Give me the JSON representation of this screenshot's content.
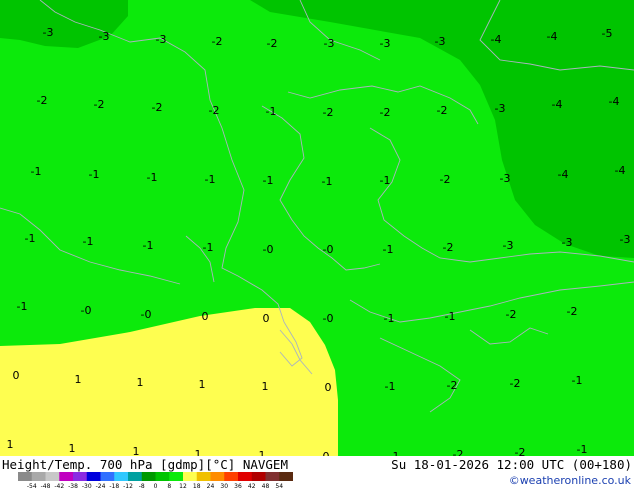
{
  "colors": {
    "dark_green": "#00c400",
    "light_green": "#0cea0b",
    "yellow": "#fefe50",
    "coast": "#aab4bf",
    "credit": "#1a3fb0"
  },
  "labels": [
    {
      "t": "-3"
    },
    {
      "t": "-3"
    },
    {
      "t": "-3"
    },
    {
      "t": "-2"
    },
    {
      "t": "-2"
    },
    {
      "t": "-3"
    },
    {
      "t": "-3"
    },
    {
      "t": "-3"
    },
    {
      "t": "-4"
    },
    {
      "t": "-4"
    },
    {
      "t": "-5"
    },
    {
      "t": "-2"
    },
    {
      "t": "-2"
    },
    {
      "t": "-2"
    },
    {
      "t": "-2"
    },
    {
      "t": "-1"
    },
    {
      "t": "-2"
    },
    {
      "t": "-2"
    },
    {
      "t": "-2"
    },
    {
      "t": "-3"
    },
    {
      "t": "-4"
    },
    {
      "t": "-4"
    },
    {
      "t": "-1"
    },
    {
      "t": "-1"
    },
    {
      "t": "-1"
    },
    {
      "t": "-1"
    },
    {
      "t": "-1"
    },
    {
      "t": "-1"
    },
    {
      "t": "-1"
    },
    {
      "t": "-2"
    },
    {
      "t": "-3"
    },
    {
      "t": "-4"
    },
    {
      "t": "-4"
    },
    {
      "t": "-1"
    },
    {
      "t": "-1"
    },
    {
      "t": "-1"
    },
    {
      "t": "-1"
    },
    {
      "t": "-0"
    },
    {
      "t": "-0"
    },
    {
      "t": "-1"
    },
    {
      "t": "-2"
    },
    {
      "t": "-3"
    },
    {
      "t": "-3"
    },
    {
      "t": "-3"
    },
    {
      "t": "-1"
    },
    {
      "t": "-0"
    },
    {
      "t": "-0"
    },
    {
      "t": "0"
    },
    {
      "t": "0"
    },
    {
      "t": "-0"
    },
    {
      "t": "-1"
    },
    {
      "t": "-1"
    },
    {
      "t": "-2"
    },
    {
      "t": "-2"
    },
    {
      "t": "0"
    },
    {
      "t": "1"
    },
    {
      "t": "1"
    },
    {
      "t": "1"
    },
    {
      "t": "1"
    },
    {
      "t": "0"
    },
    {
      "t": "-1"
    },
    {
      "t": "-2"
    },
    {
      "t": "-2"
    },
    {
      "t": "-1"
    },
    {
      "t": "1"
    },
    {
      "t": "1"
    },
    {
      "t": "1"
    },
    {
      "t": "1"
    },
    {
      "t": "1"
    },
    {
      "t": "0"
    },
    {
      "t": "-1"
    },
    {
      "t": "-2"
    },
    {
      "t": "-2"
    },
    {
      "t": "-1"
    }
  ],
  "footer": {
    "left": "Height/Temp. 700 hPa [gdmp][°C] NAVGEM",
    "right": "Su 18-01-2026 12:00 UTC (00+180)",
    "credit": "©weatheronline.co.uk"
  },
  "scale": {
    "ticks": [
      "-54",
      "-48",
      "-42",
      "-38",
      "-30",
      "-24",
      "-18",
      "-12",
      "-8",
      "0",
      "8",
      "12",
      "18",
      "24",
      "30",
      "36",
      "42",
      "48",
      "54"
    ],
    "colors": [
      "#8a8a8a",
      "#a9a9a9",
      "#c8c8c8",
      "#c000c0",
      "#8a2be2",
      "#0000dd",
      "#3070ff",
      "#30c8ff",
      "#00a0a0",
      "#009900",
      "#00c400",
      "#0cea0b",
      "#fefe50",
      "#f0c000",
      "#ff8c00",
      "#ff4000",
      "#e00000",
      "#b00000",
      "#803030",
      "#5a2a10"
    ]
  }
}
